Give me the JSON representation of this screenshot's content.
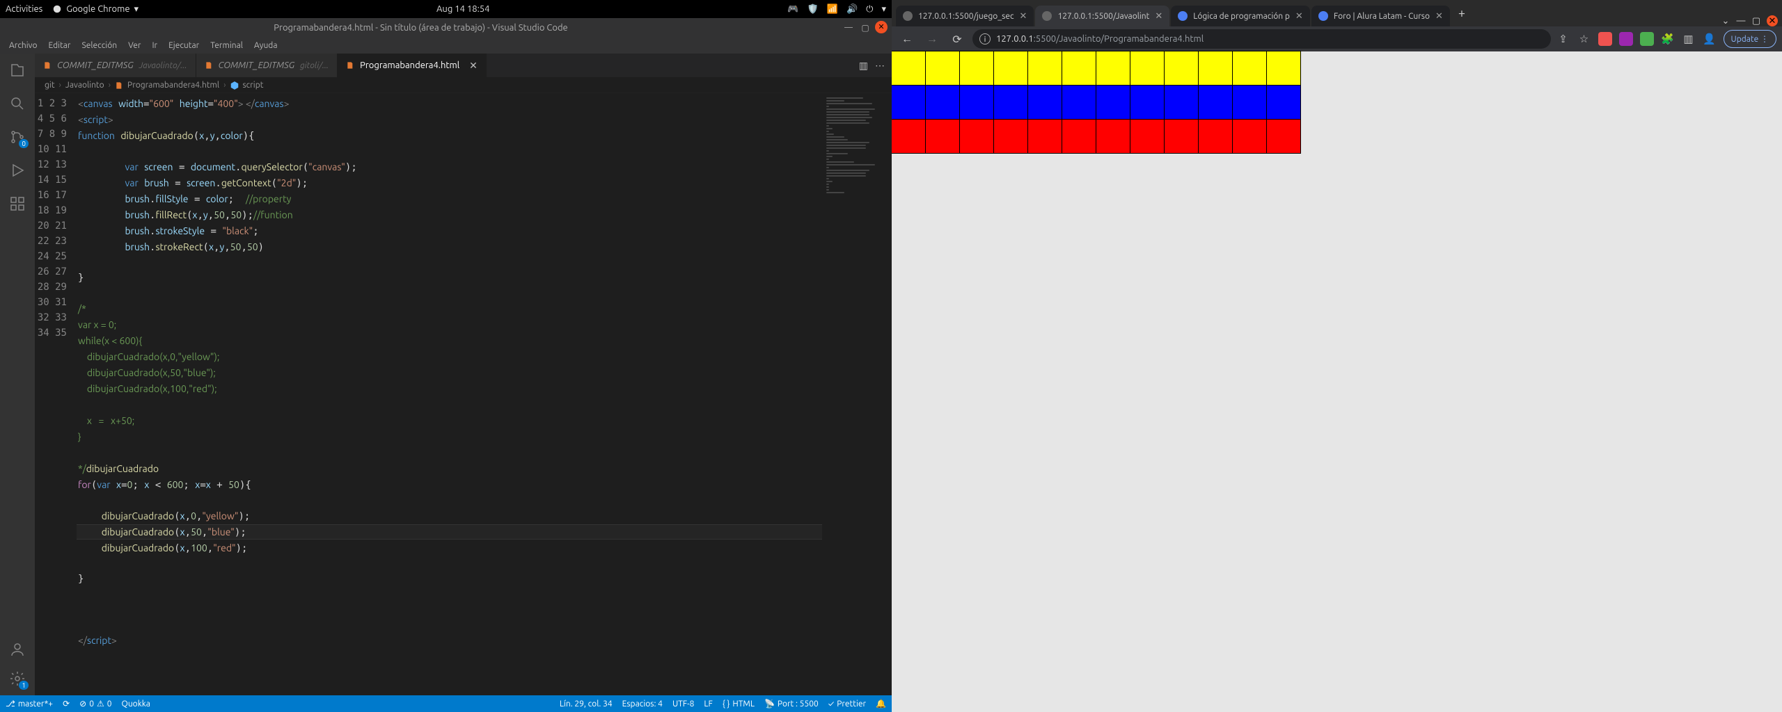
{
  "gnome": {
    "activities": "Activities",
    "app": "Google Chrome",
    "clock": "Aug 14  18:54"
  },
  "vscode": {
    "title": "Programabandera4.html - Sin título (área de trabajo) - Visual Studio Code",
    "menu": [
      "Archivo",
      "Editar",
      "Selección",
      "Ver",
      "Ir",
      "Ejecutar",
      "Terminal",
      "Ayuda"
    ],
    "tabs": [
      {
        "label": "COMMIT_EDITMSG",
        "hint": "Javaolinto/..."
      },
      {
        "label": "COMMIT_EDITMSG",
        "hint": "gitoli/..."
      },
      {
        "label": "Programabandera4.html",
        "active": true
      }
    ],
    "breadcrumbs": [
      "git",
      "Javaolinto",
      "Programabandera4.html",
      "script"
    ],
    "status": {
      "branch": "master*+",
      "errors": "0",
      "warnings": "0",
      "quokka": "Quokka",
      "cursor": "Lín. 29, col. 34",
      "spaces": "Espacios: 4",
      "encoding": "UTF-8",
      "eol": "LF",
      "lang": "HTML",
      "port": "Port : 5500",
      "prettier": "Prettier",
      "bell": "🔔"
    },
    "activity_badge_sc": "0",
    "activity_badge_gear": "1",
    "line_count": 35,
    "highlight_line": 29
  },
  "chrome": {
    "tabs": [
      {
        "title": "127.0.0.1:5500/juego_sec",
        "fav": "globe"
      },
      {
        "title": "127.0.0.1:5500/Javaolint",
        "fav": "globe",
        "active": true
      },
      {
        "title": "Lógica de programación p",
        "fav": "a"
      },
      {
        "title": "Foro | Alura Latam - Curso",
        "fav": "a"
      }
    ],
    "url_host": "127.0.0.1",
    "url_path": ":5500/Javaolinto/Programabandera4.html",
    "update": "Update"
  },
  "flag": {
    "cols": 12,
    "rows": [
      {
        "color": "yellow",
        "hex": "#ffff00"
      },
      {
        "color": "blue",
        "hex": "#0000ff"
      },
      {
        "color": "red",
        "hex": "#ff0000"
      }
    ]
  }
}
